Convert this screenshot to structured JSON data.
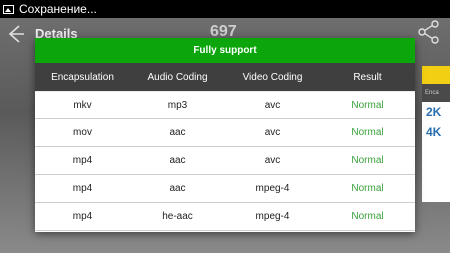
{
  "status_bar": {
    "text": "Сохранение..."
  },
  "header": {
    "title": "Details",
    "number": "697"
  },
  "side_card": {
    "sub": "Enca",
    "tags": [
      "2K",
      "4K"
    ]
  },
  "dialog": {
    "title": "Fully support",
    "columns": [
      "Encapsulation",
      "Audio Coding",
      "Video Coding",
      "Result"
    ],
    "rows": [
      [
        "mkv",
        "mp3",
        "avc",
        "Normal"
      ],
      [
        "mov",
        "aac",
        "avc",
        "Normal"
      ],
      [
        "mp4",
        "aac",
        "avc",
        "Normal"
      ],
      [
        "mp4",
        "aac",
        "mpeg-4",
        "Normal"
      ],
      [
        "mp4",
        "he-aac",
        "mpeg-4",
        "Normal"
      ]
    ]
  },
  "colors": {
    "header_green": "#0ca60c",
    "result_green": "#39a23b",
    "table_head": "#3f3f3f"
  },
  "icons": {
    "back": "back-arrow-icon",
    "share": "share-icon",
    "status": "image-icon"
  }
}
